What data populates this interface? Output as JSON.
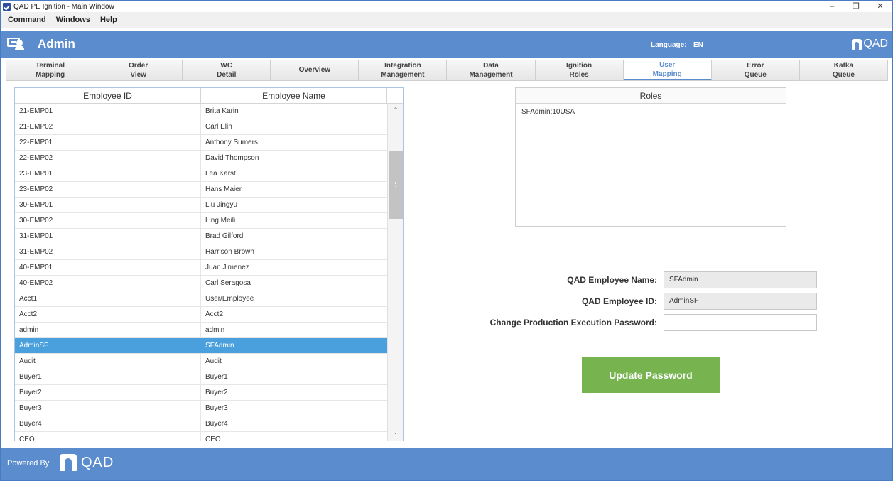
{
  "window": {
    "title": "QAD PE Ignition - Main Window",
    "controls": [
      "–",
      "❐",
      "✕"
    ]
  },
  "menu": [
    "Command",
    "Windows",
    "Help"
  ],
  "header": {
    "title": "Admin",
    "language_label": "Language:",
    "language_value": "EN",
    "logo_text": "QAD",
    "bar_color": "#5b8ccd"
  },
  "tabs": [
    {
      "label": "Terminal\nMapping"
    },
    {
      "label": "Order\nView"
    },
    {
      "label": "WC\nDetail"
    },
    {
      "label": "Overview"
    },
    {
      "label": "Integration\nManagement"
    },
    {
      "label": "Data\nManagement"
    },
    {
      "label": "Ignition\nRoles"
    },
    {
      "label": "User\nMapping"
    },
    {
      "label": "Error\nQueue"
    },
    {
      "label": "Kafka\nQueue"
    }
  ],
  "active_tab": "User Mapping",
  "employees": {
    "headers": [
      "Employee ID",
      "Employee Name"
    ],
    "rows": [
      {
        "id": "21-EMP01",
        "name": "Brita Karin"
      },
      {
        "id": "21-EMP02",
        "name": "Carl Elin"
      },
      {
        "id": "22-EMP01",
        "name": "Anthony Sumers"
      },
      {
        "id": "22-EMP02",
        "name": "David Thompson"
      },
      {
        "id": "23-EMP01",
        "name": "Lea Karst"
      },
      {
        "id": "23-EMP02",
        "name": "Hans Maier"
      },
      {
        "id": "30-EMP01",
        "name": "Liu Jingyu"
      },
      {
        "id": "30-EMP02",
        "name": "Ling Meili"
      },
      {
        "id": "31-EMP01",
        "name": "Brad Gilford"
      },
      {
        "id": "31-EMP02",
        "name": "Harrison Brown"
      },
      {
        "id": "40-EMP01",
        "name": "Juan Jimenez"
      },
      {
        "id": "40-EMP02",
        "name": "Carl Seragosa"
      },
      {
        "id": "Acct1",
        "name": "User/Employee"
      },
      {
        "id": "Acct2",
        "name": "Acct2"
      },
      {
        "id": "admin",
        "name": "admin"
      },
      {
        "id": "AdminSF",
        "name": "SFAdmin"
      },
      {
        "id": "Audit",
        "name": "Audit"
      },
      {
        "id": "Buyer1",
        "name": "Buyer1"
      },
      {
        "id": "Buyer2",
        "name": "Buyer2"
      },
      {
        "id": "Buyer3",
        "name": "Buyer3"
      },
      {
        "id": "Buyer4",
        "name": "Buyer4"
      },
      {
        "id": "CEO",
        "name": "CEO"
      }
    ],
    "selected_id": "AdminSF",
    "selected_color": "#4aa0dc"
  },
  "roles": {
    "header": "Roles",
    "items": [
      "SFAdmin;10USA"
    ]
  },
  "form": {
    "name_label": "QAD Employee Name:",
    "name_value": "SFAdmin",
    "id_label": "QAD Employee ID:",
    "id_value": "AdminSF",
    "password_label": "Change Production Execution Password:",
    "password_value": "",
    "update_button": "Update Password",
    "button_color": "#77b450"
  },
  "footer": {
    "powered_by": "Powered By",
    "logo_text": "QAD"
  }
}
